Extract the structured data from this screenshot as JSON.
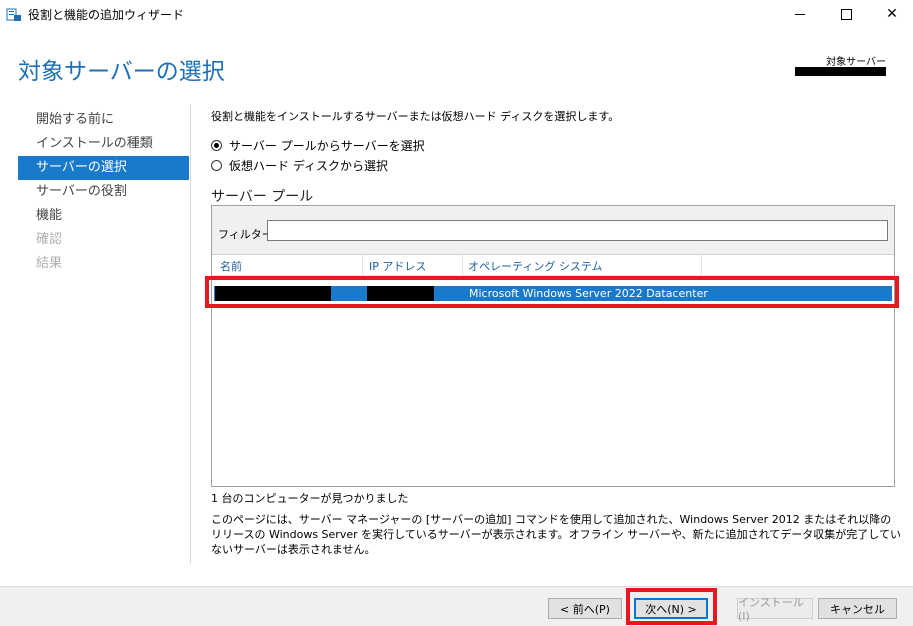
{
  "window": {
    "title": "役割と機能の追加ウィザード",
    "icon": "server-manager-icon"
  },
  "header": {
    "title": "対象サーバーの選択",
    "target_label": "対象サーバー"
  },
  "nav": {
    "items": [
      {
        "label": "開始する前に",
        "state": "normal"
      },
      {
        "label": "インストールの種類",
        "state": "normal"
      },
      {
        "label": "サーバーの選択",
        "state": "active"
      },
      {
        "label": "サーバーの役割",
        "state": "normal"
      },
      {
        "label": "機能",
        "state": "normal"
      },
      {
        "label": "確認",
        "state": "disabled"
      },
      {
        "label": "結果",
        "state": "disabled"
      }
    ]
  },
  "content": {
    "description": "役割と機能をインストールするサーバーまたは仮想ハード ディスクを選択します。",
    "radio_pool": "サーバー プールからサーバーを選択",
    "radio_vhd": "仮想ハード ディスクから選択",
    "pool_title": "サーバー プール",
    "filter_label": "フィルター:",
    "filter_value": "",
    "columns": {
      "name": "名前",
      "ip": "IP アドレス",
      "os": "オペレーティング システム"
    },
    "rows": [
      {
        "os": "Microsoft Windows Server 2022 Datacenter"
      }
    ],
    "found": "1 台のコンピューターが見つかりました",
    "info": "このページには、サーバー マネージャーの [サーバーの追加] コマンドを使用して追加された、Windows Server 2012 またはそれ以降のリリースの Windows Server を実行しているサーバーが表示されます。オフライン サーバーや、新たに追加されてデータ収集が完了していないサーバーは表示されません。"
  },
  "footer": {
    "prev": "< 前へ(P)",
    "next": "次へ(N) >",
    "install": "インストール(I)",
    "cancel": "キャンセル"
  },
  "colors": {
    "accent": "#1979ca",
    "title_blue": "#1f6fb5",
    "annotation_red": "#e4181f"
  }
}
